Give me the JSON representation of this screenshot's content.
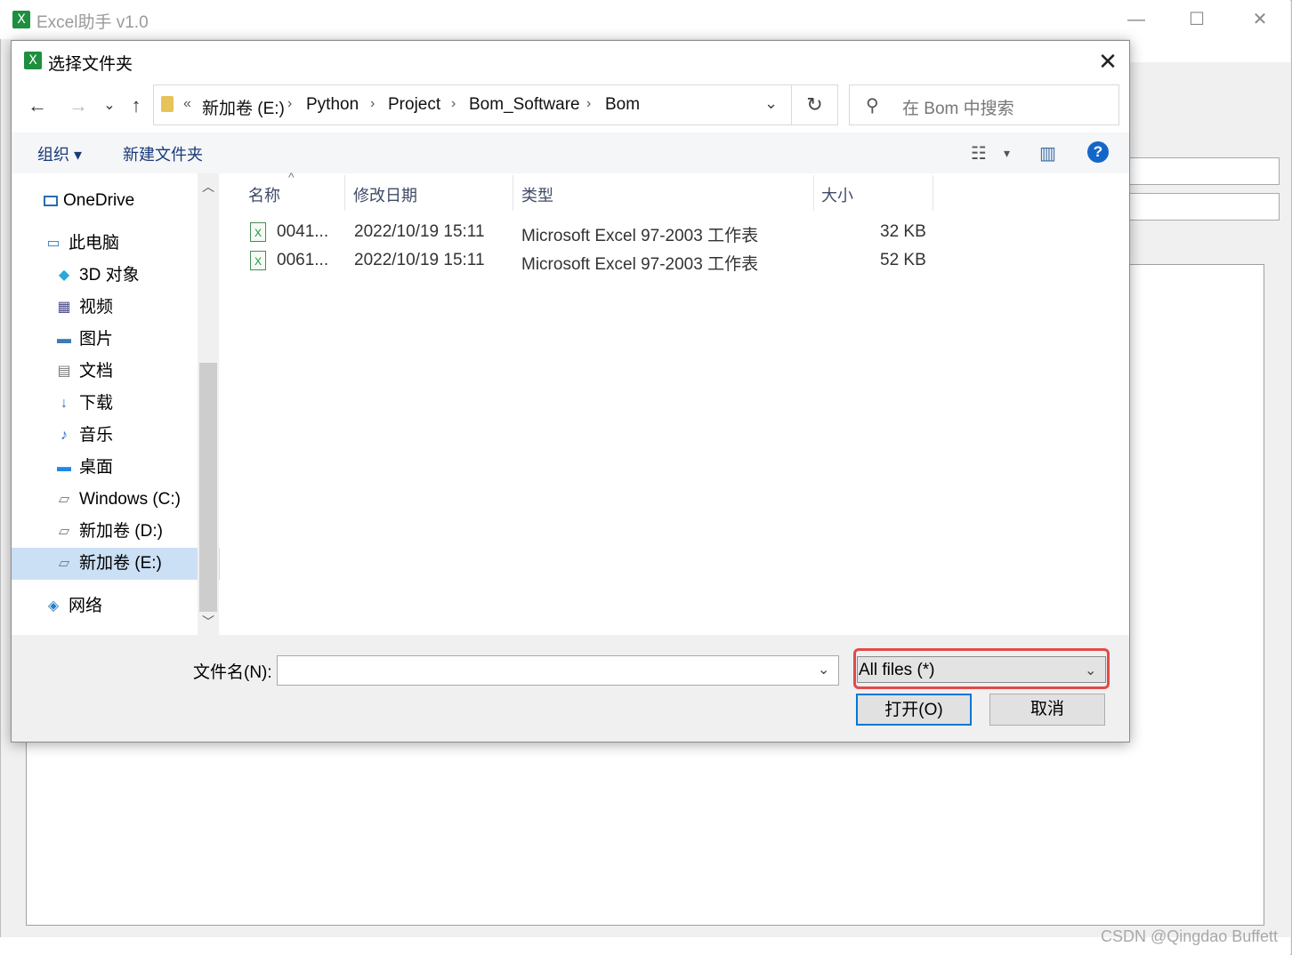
{
  "main_window": {
    "title": "Excel助手 v1.0",
    "app_icon_glyph": "X",
    "minimize_glyph": "—",
    "maximize_glyph": "☐",
    "close_glyph": "✕",
    "credit": "CSDN @Qingdao Buffett"
  },
  "dialog": {
    "title": "选择文件夹",
    "close_glyph": "✕",
    "nav": {
      "back_glyph": "←",
      "forward_glyph": "→",
      "recent_glyph": "⌄",
      "up_glyph": "↑"
    },
    "address": {
      "overflow": "«",
      "separator": "›",
      "crumbs": [
        "新加卷 (E:)",
        "Python",
        "Project",
        "Bom_Software",
        "Bom"
      ],
      "dropdown_glyph": "⌄",
      "refresh_glyph": "↻"
    },
    "search": {
      "placeholder": "在 Bom 中搜索",
      "icon_glyph": "⚲"
    },
    "toolbar": {
      "organize": "组织 ▾",
      "new_folder": "新建文件夹",
      "view_glyph": "☷",
      "view_dd": "▾",
      "preview_glyph": "▥",
      "help_glyph": "?"
    },
    "nav_pane": {
      "items": [
        {
          "label": "OneDrive",
          "icon": "onedrive-icon"
        },
        {
          "label": "此电脑",
          "icon": "computer-icon"
        },
        {
          "label": "3D 对象",
          "icon": "3d-objects-icon"
        },
        {
          "label": "视频",
          "icon": "videos-icon"
        },
        {
          "label": "图片",
          "icon": "pictures-icon"
        },
        {
          "label": "文档",
          "icon": "documents-icon"
        },
        {
          "label": "下载",
          "icon": "downloads-icon"
        },
        {
          "label": "音乐",
          "icon": "music-icon"
        },
        {
          "label": "桌面",
          "icon": "desktop-icon"
        },
        {
          "label": "Windows (C:)",
          "icon": "drive-c-icon"
        },
        {
          "label": "新加卷 (D:)",
          "icon": "drive-d-icon"
        },
        {
          "label": "新加卷 (E:)",
          "icon": "drive-e-icon",
          "selected": true
        },
        {
          "label": "网络",
          "icon": "network-icon"
        }
      ],
      "scroll_up_glyph": "︿",
      "scroll_down_glyph": "﹀"
    },
    "columns": {
      "name": "名称",
      "modified": "修改日期",
      "type": "类型",
      "size": "大小",
      "sort_glyph": "^"
    },
    "files": [
      {
        "name": "0041...",
        "modified": "2022/10/19 15:11",
        "type": "Microsoft Excel 97-2003 工作表",
        "size": "32 KB"
      },
      {
        "name": "0061...",
        "modified": "2022/10/19 15:11",
        "type": "Microsoft Excel 97-2003 工作表",
        "size": "52 KB"
      }
    ],
    "filename": {
      "label": "文件名(N):",
      "value": "",
      "dropdown_glyph": "⌄"
    },
    "filetype": {
      "value": "All files (*)",
      "dropdown_glyph": "⌄"
    },
    "buttons": {
      "open": "打开(O)",
      "cancel": "取消"
    }
  }
}
